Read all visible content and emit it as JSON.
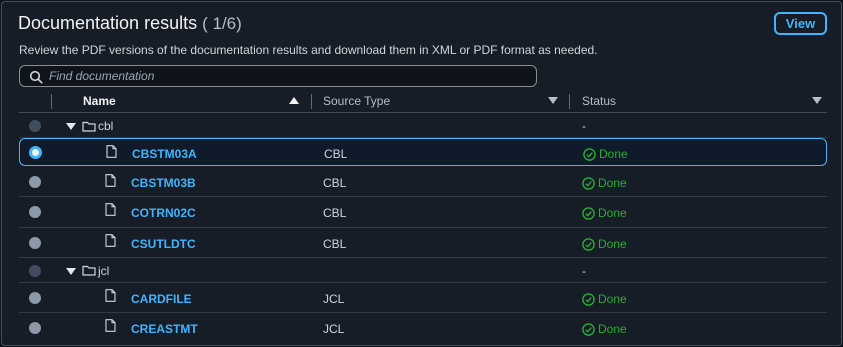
{
  "header": {
    "title": "Documentation results",
    "count": "( 1/6)",
    "view_button": "View",
    "description": "Review the PDF versions of the documentation results and download them in XML or PDF format as needed.",
    "search_placeholder": "Find documentation"
  },
  "table": {
    "columns": {
      "name": "Name",
      "source_type": "Source Type",
      "status": "Status"
    },
    "groups": [
      {
        "folder": "cbl",
        "status": "-",
        "files": [
          {
            "name": "CBSTM03A",
            "source_type": "CBL",
            "status": "Done",
            "selected": true
          },
          {
            "name": "CBSTM03B",
            "source_type": "CBL",
            "status": "Done",
            "selected": false
          },
          {
            "name": "COTRN02C",
            "source_type": "CBL",
            "status": "Done",
            "selected": false
          },
          {
            "name": "CSUTLDTC",
            "source_type": "CBL",
            "status": "Done",
            "selected": false
          }
        ]
      },
      {
        "folder": "jcl",
        "status": "-",
        "files": [
          {
            "name": "CARDFILE",
            "source_type": "JCL",
            "status": "Done",
            "selected": false
          },
          {
            "name": "CREASTMT",
            "source_type": "JCL",
            "status": "Done",
            "selected": false
          }
        ]
      }
    ]
  },
  "colors": {
    "accent": "#42b4ff",
    "success": "#29ad32",
    "background": "#161d26"
  }
}
